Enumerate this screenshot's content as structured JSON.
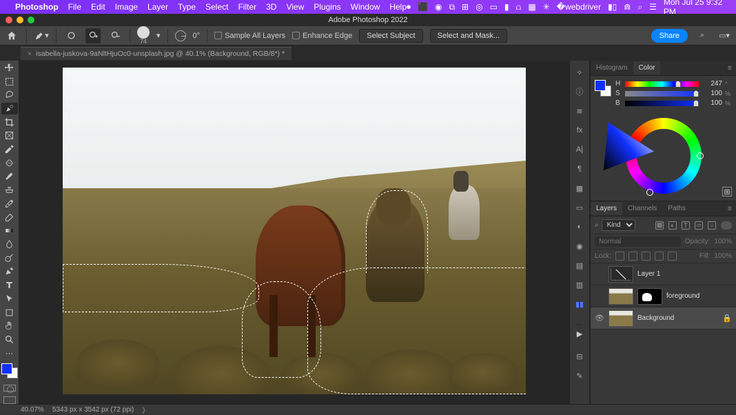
{
  "menubar": {
    "app": "Photoshop",
    "items": [
      "File",
      "Edit",
      "Image",
      "Layer",
      "Type",
      "Select",
      "Filter",
      "3D",
      "View",
      "Plugins",
      "Window",
      "Help"
    ],
    "datetime": "Mon Jul 25  9:32 PM"
  },
  "window": {
    "title": "Adobe Photoshop 2022"
  },
  "options": {
    "brush_size": "74",
    "angle": "0°",
    "sample_all": "Sample All Layers",
    "enhance_edge": "Enhance Edge",
    "select_subject": "Select Subject",
    "select_and_mask": "Select and Mask...",
    "share": "Share"
  },
  "tab": {
    "label": "isabella-juskova-9aNltHjuOc0-unsplash.jpg @ 40.1% (Background, RGB/8*) *"
  },
  "tools": [
    "move",
    "rect-marquee",
    "lasso",
    "quick-selection",
    "crop",
    "frame",
    "eyedropper",
    "healing",
    "brush",
    "clone",
    "history-brush",
    "eraser",
    "gradient",
    "blur",
    "dodge",
    "pen",
    "type",
    "path-select",
    "rectangle",
    "hand",
    "zoom",
    "edit-toolbar"
  ],
  "active_tool": "quick-selection",
  "swatch": {
    "foreground": "#1030ff",
    "background": "#ffffff"
  },
  "histogram_tab": "Histogram",
  "color_tab": "Color",
  "hsb": {
    "h": {
      "label": "H",
      "value": "247",
      "unit": "°",
      "pos": 68
    },
    "s": {
      "label": "S",
      "value": "100",
      "unit": "%",
      "pos": 100
    },
    "b": {
      "label": "B",
      "value": "100",
      "unit": "%",
      "pos": 100
    }
  },
  "layers_tabs": {
    "layers": "Layers",
    "channels": "Channels",
    "paths": "Paths"
  },
  "layer_filter": {
    "kind_label": "Kind"
  },
  "blend": {
    "mode": "Normal",
    "opacity_label": "Opacity:",
    "opacity": "100%"
  },
  "lock": {
    "label": "Lock:",
    "fill_label": "Fill:",
    "fill": "100%"
  },
  "layers": [
    {
      "name": "Layer 1",
      "visible": false,
      "type": "curves"
    },
    {
      "name": "foreground",
      "visible": false,
      "type": "image",
      "has_mask": true
    },
    {
      "name": "Background",
      "visible": true,
      "type": "image",
      "locked": true,
      "selected": true
    }
  ],
  "status": {
    "zoom": "40.07%",
    "dims": "5343 px x 3542 px (72 ppi)"
  }
}
